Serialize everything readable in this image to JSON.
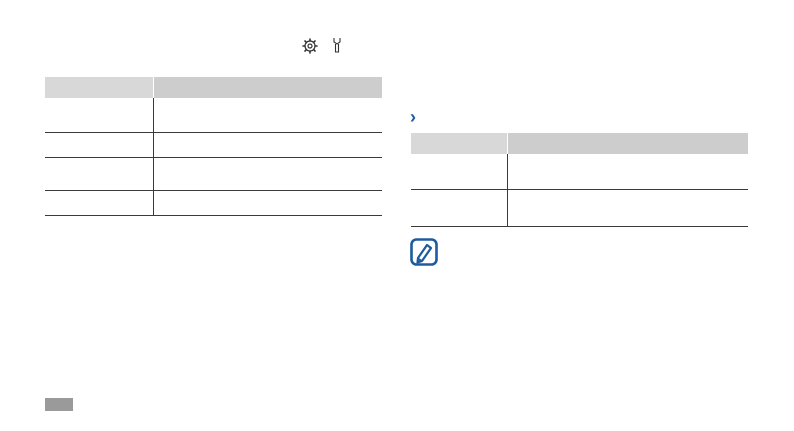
{
  "header": {
    "icons": [
      "settings-gear-icon",
      "wrench-icon"
    ]
  },
  "left_table": {
    "headers": [
      "",
      ""
    ],
    "rows": [
      {
        "cells": [
          "",
          ""
        ]
      },
      {
        "cells": [
          "",
          ""
        ]
      },
      {
        "cells": [
          "",
          ""
        ]
      },
      {
        "cells": [
          "",
          ""
        ]
      }
    ]
  },
  "right_section": {
    "bullet_icon": "chevron-right-icon",
    "table": {
      "headers": [
        "",
        ""
      ],
      "rows": [
        {
          "cells": [
            "",
            ""
          ]
        },
        {
          "cells": [
            "",
            ""
          ]
        }
      ]
    }
  },
  "note": {
    "icon": "note-pencil-icon",
    "icon_color": "#1e5aa0"
  },
  "footer": {
    "page_tab_color": "#9a9a9a"
  }
}
